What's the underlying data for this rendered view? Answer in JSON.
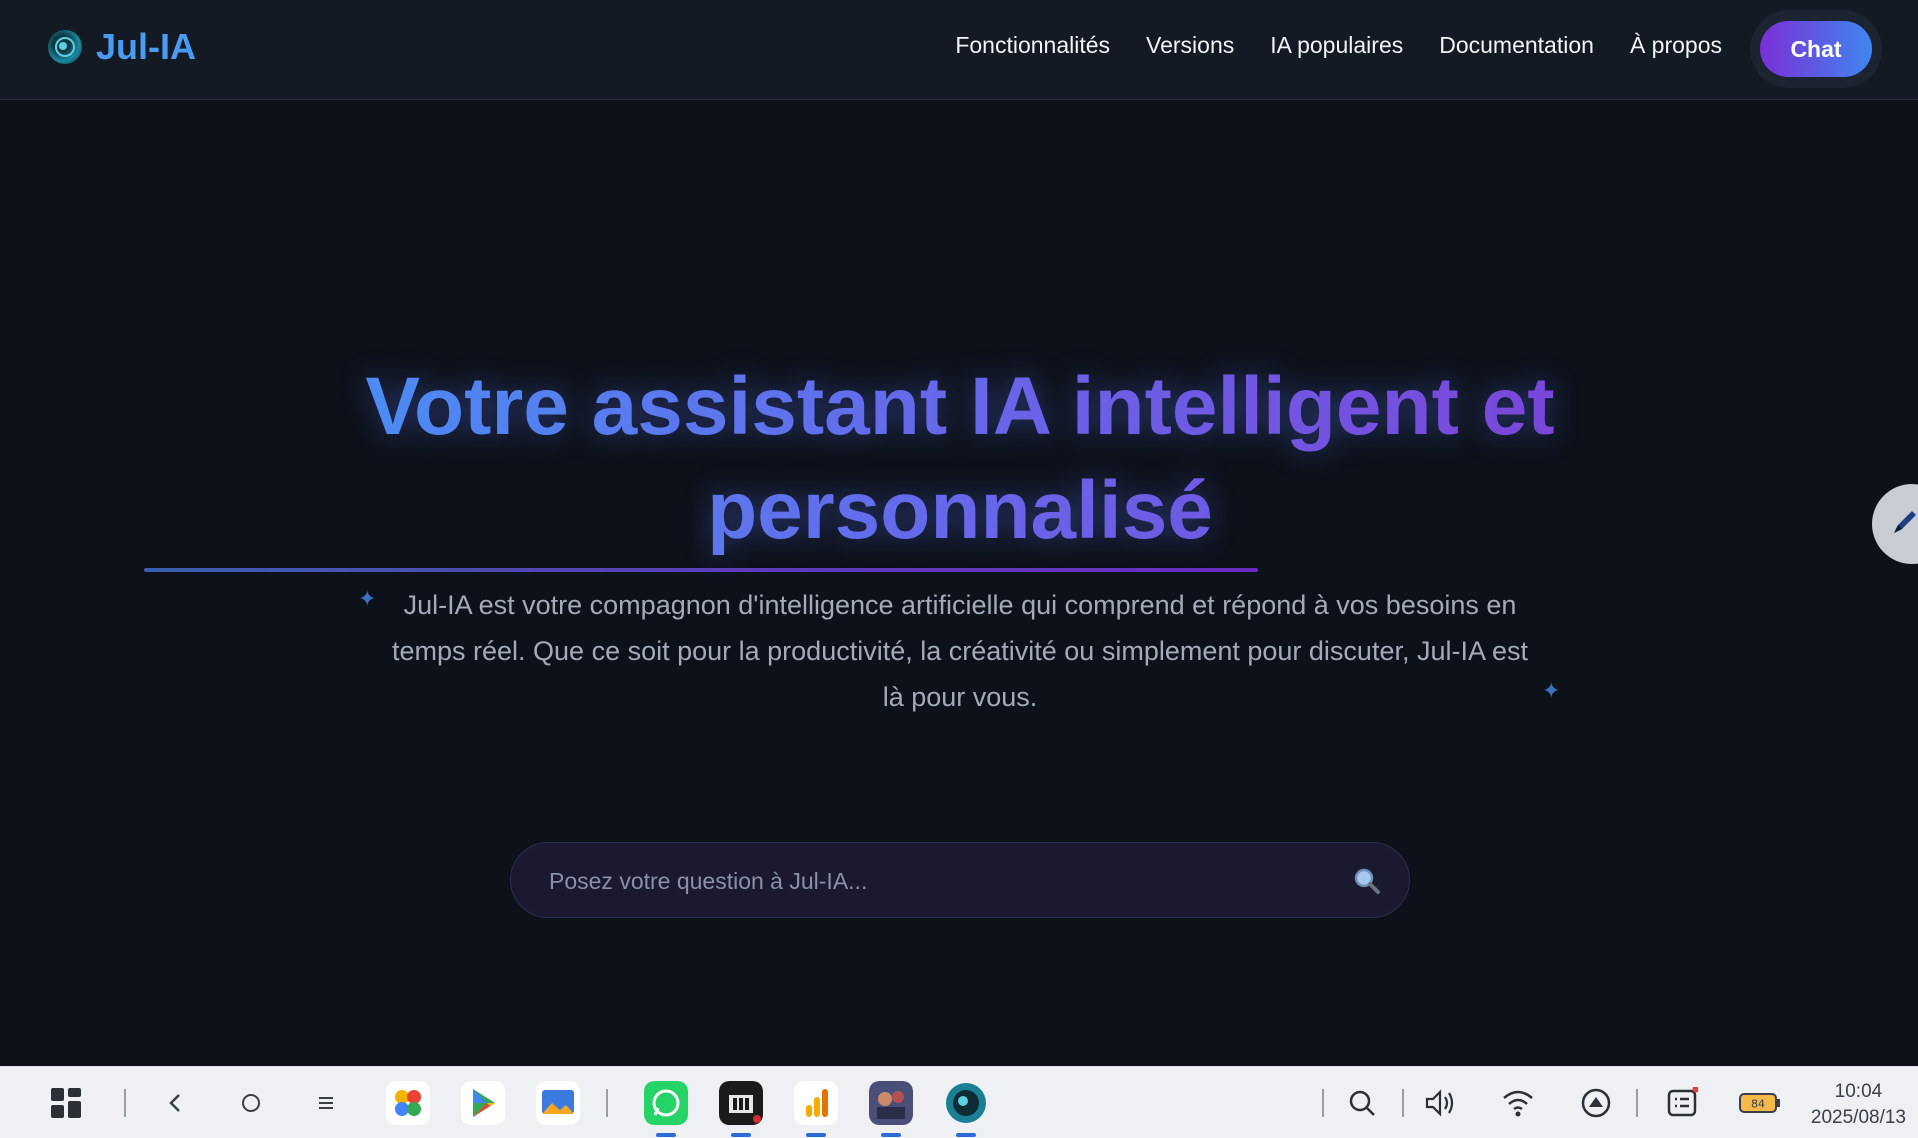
{
  "brand": {
    "name": "Jul-IA"
  },
  "nav": {
    "links": [
      "Fonctionnalités",
      "Versions",
      "IA populaires",
      "Documentation",
      "À propos"
    ],
    "chat_label": "Chat"
  },
  "hero": {
    "title": "Votre assistant IA intelligent et personnalisé",
    "description": "Jul-IA est votre compagnon d'intelligence artificielle qui comprend et répond à vos besoins en temps réel. Que ce soit pour la productivité, la créativité ou simplement pour discuter, Jul-IA est là pour vous.",
    "sparkle": "✦"
  },
  "search": {
    "placeholder": "Posez votre question à Jul-IA...",
    "icon": "search-icon"
  },
  "taskbar": {
    "apps": [
      "photos",
      "play-store",
      "gallery",
      "whatsapp",
      "world-war-game",
      "analytics",
      "strategy-game",
      "jul-ia"
    ],
    "battery": "84",
    "time": "10:04",
    "date": "2025/08/13"
  },
  "colors": {
    "accent_blue": "#4a9bf2",
    "accent_purple": "#7a2fd6",
    "background": "#0d111a"
  }
}
